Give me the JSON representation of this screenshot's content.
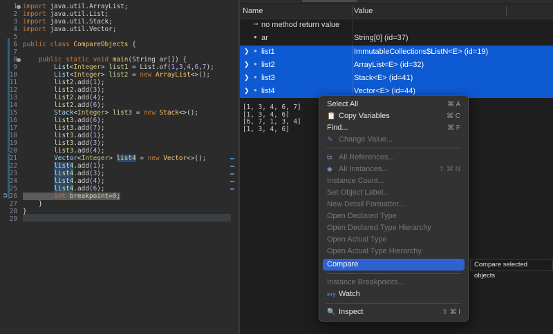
{
  "editor": {
    "lines": [
      {
        "n": "1",
        "t": "import java.util.ArrayList;"
      },
      {
        "n": "2",
        "t": "import java.util.List;"
      },
      {
        "n": "3",
        "t": "import java.util.Stack;"
      },
      {
        "n": "4",
        "t": "import java.util.Vector;"
      },
      {
        "n": "5",
        "t": ""
      },
      {
        "n": "6",
        "t": "public class CompareObjects {"
      },
      {
        "n": "7",
        "t": ""
      },
      {
        "n": "8",
        "t": "    public static void main(String ar[]) {"
      },
      {
        "n": "9",
        "t": "        List<Integer> list1 = List.of(1,3,4,6,7);"
      },
      {
        "n": "10",
        "t": "        List<Integer> list2 = new ArrayList<>();"
      },
      {
        "n": "11",
        "t": "        list2.add(1);"
      },
      {
        "n": "12",
        "t": "        list2.add(3);"
      },
      {
        "n": "13",
        "t": "        list2.add(4);"
      },
      {
        "n": "14",
        "t": "        list2.add(6);"
      },
      {
        "n": "15",
        "t": "        Stack<Integer> list3 = new Stack<>();"
      },
      {
        "n": "16",
        "t": "        list3.add(6);"
      },
      {
        "n": "17",
        "t": "        list3.add(7);"
      },
      {
        "n": "18",
        "t": "        list3.add(1);"
      },
      {
        "n": "19",
        "t": "        list3.add(3);"
      },
      {
        "n": "20",
        "t": "        list3.add(4);"
      },
      {
        "n": "21",
        "t": "        Vector<Integer> list4 = new Vector<>();"
      },
      {
        "n": "22",
        "t": "        list4.add(1);"
      },
      {
        "n": "23",
        "t": "        list4.add(3);"
      },
      {
        "n": "24",
        "t": "        list4.add(4);"
      },
      {
        "n": "25",
        "t": "        list4.add(6);"
      },
      {
        "n": "26",
        "t": "        int breakpoint=0;"
      },
      {
        "n": "27",
        "t": "    }"
      },
      {
        "n": "28",
        "t": "}"
      },
      {
        "n": "29",
        "t": ""
      }
    ]
  },
  "variables": {
    "header_name": "Name",
    "header_value": "Value",
    "rows": [
      {
        "name": "no method return value",
        "value": "",
        "icon": "return-icon",
        "expandable": false,
        "selected": false
      },
      {
        "name": "ar",
        "value": "String[0]  (id=37)",
        "icon": "field-dot-icon",
        "expandable": false,
        "selected": false
      },
      {
        "name": "list1",
        "value": "ImmutableCollections$ListN<E>  (id=19)",
        "icon": "field-dot-icon",
        "expandable": true,
        "selected": true
      },
      {
        "name": "list2",
        "value": "ArrayList<E>  (id=32)",
        "icon": "field-dot-icon",
        "expandable": true,
        "selected": true
      },
      {
        "name": "list3",
        "value": "Stack<E>  (id=41)",
        "icon": "field-dot-icon",
        "expandable": true,
        "selected": true
      },
      {
        "name": "list4",
        "value": "Vector<E>  (id=44)",
        "icon": "field-dot-icon",
        "expandable": true,
        "selected": true
      }
    ],
    "detail_lines": [
      "[1, 3, 4, 6, 7]",
      "[1, 3, 4, 6]",
      "[6, 7, 1, 3, 4]",
      "[1, 3, 4, 6]"
    ]
  },
  "menu": {
    "items": [
      {
        "label": "Select All",
        "shortcut": "⌘ A",
        "enabled": true,
        "icon": ""
      },
      {
        "label": "Copy Variables",
        "shortcut": "⌘ C",
        "enabled": true,
        "icon": "copy-icon"
      },
      {
        "label": "Find...",
        "shortcut": "⌘ F",
        "enabled": true,
        "icon": ""
      },
      {
        "label": "Change Value...",
        "shortcut": "",
        "enabled": false,
        "icon": "change-value-icon"
      },
      {
        "label": "All References...",
        "shortcut": "",
        "enabled": false,
        "icon": "references-icon"
      },
      {
        "label": "All Instances...",
        "shortcut": "⇧ ⌘ N",
        "enabled": false,
        "icon": "instances-icon"
      },
      {
        "label": "Instance Count...",
        "shortcut": "",
        "enabled": false,
        "icon": ""
      },
      {
        "label": "Set Object Label...",
        "shortcut": "",
        "enabled": false,
        "icon": ""
      },
      {
        "label": "New Detail Formatter...",
        "shortcut": "",
        "enabled": false,
        "icon": ""
      },
      {
        "label": "Open Declared Type",
        "shortcut": "",
        "enabled": false,
        "icon": ""
      },
      {
        "label": "Open Declared Type Hierarchy",
        "shortcut": "",
        "enabled": false,
        "icon": ""
      },
      {
        "label": "Open Actual Type",
        "shortcut": "",
        "enabled": false,
        "icon": ""
      },
      {
        "label": "Open Actual Type Hierarchy",
        "shortcut": "",
        "enabled": false,
        "icon": ""
      },
      {
        "label": "Compare",
        "shortcut": "",
        "enabled": true,
        "icon": "",
        "active": true
      },
      {
        "label": "Instance Breakpoints...",
        "shortcut": "",
        "enabled": false,
        "icon": ""
      },
      {
        "label": "Watch",
        "shortcut": "",
        "enabled": true,
        "icon": "watch-icon"
      },
      {
        "label": "Inspect",
        "shortcut": "⇧ ⌘ I",
        "enabled": true,
        "icon": "inspect-icon"
      }
    ],
    "tooltip": "Compare selected objects"
  },
  "colors": {
    "selection": "#0e5ad2",
    "menu_active": "#2f62d0",
    "editor_bg": "#2b2b2b"
  }
}
